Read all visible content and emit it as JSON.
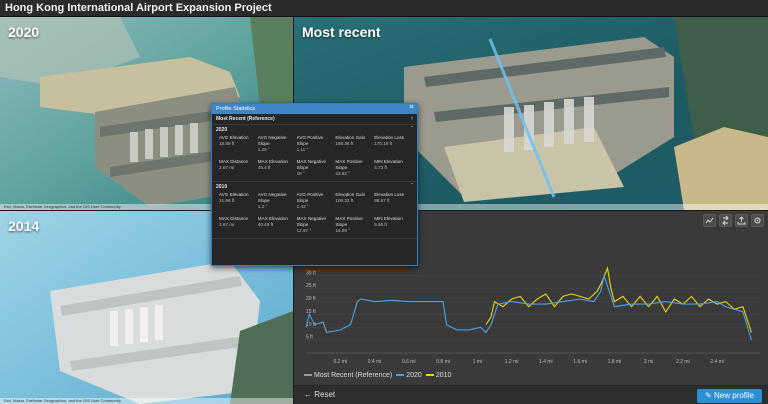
{
  "app": {
    "title": "Hong Kong International Airport Expansion Project"
  },
  "panes": {
    "p2020": {
      "label": "2020",
      "attribution": "Esri, Maxar, Earthstar Geographics, and the GIS User Community"
    },
    "recent": {
      "label": "Most recent",
      "attribution": "Esri, Maxar, Earthstar Geographics, and the GIS User Community"
    },
    "p2014": {
      "label": "2014",
      "attribution": "Esri, Maxar, Earthstar Geographics, and the GIS User Community"
    }
  },
  "stats": {
    "title": "Profile Statistics",
    "reference": "Most Recent (Reference)",
    "groups": [
      {
        "name": "2020",
        "items": [
          {
            "label": "AVG Elevation",
            "value": "18.89 ft"
          },
          {
            "label": "AVG Negative Slope",
            "value": "1.29 °"
          },
          {
            "label": "AVG Positive Slope",
            "value": "1.11 °"
          },
          {
            "label": "Elevation Gain",
            "value": "168.36 ft"
          },
          {
            "label": "Elevation Loss",
            "value": "170.18 ft"
          },
          {
            "label": "MAX Distance",
            "value": "2.67 mi"
          },
          {
            "label": "MAX Elevation",
            "value": "45.4 ft"
          },
          {
            "label": "MAX Negative Slope",
            "value": "18 °"
          },
          {
            "label": "MAX Positive Slope",
            "value": "23.82 °"
          },
          {
            "label": "MIN Elevation",
            "value": "4.73 ft"
          }
        ]
      },
      {
        "name": "2010",
        "items": [
          {
            "label": "AVG Elevation",
            "value": "21.96 ft"
          },
          {
            "label": "AVG Negative Slope",
            "value": "1.2 °"
          },
          {
            "label": "AVG Positive Slope",
            "value": "1.43 °"
          },
          {
            "label": "Elevation Gain",
            "value": "108.32 ft"
          },
          {
            "label": "Elevation Loss",
            "value": "98.57 ft"
          },
          {
            "label": "MAX Distance",
            "value": "2.67 mi"
          },
          {
            "label": "MAX Elevation",
            "value": "40.49 ft"
          },
          {
            "label": "MAX Negative Slope",
            "value": "12.97 °"
          },
          {
            "label": "MAX Positive Slope",
            "value": "16.09 °"
          },
          {
            "label": "MIN Elevation",
            "value": "5.95 ft"
          }
        ]
      }
    ]
  },
  "profile": {
    "yticks": [
      "30 ft",
      "25 ft",
      "20 ft",
      "15 ft",
      "10 ft",
      "5 ft"
    ],
    "xticks": [
      "0.2 mi",
      "0.4 mi",
      "0.6 mi",
      "0.8 mi",
      "1 mi",
      "1.2 mi",
      "1.4 mi",
      "1.6 mi",
      "1.8 mi",
      "2 mi",
      "2.2 mi",
      "2.4 mi"
    ],
    "legend": [
      {
        "name": "Most Recent (Reference)",
        "color": "#9a9a9a"
      },
      {
        "name": "2020",
        "color": "#4aa3e8"
      },
      {
        "name": "2010",
        "color": "#f0d400"
      }
    ],
    "series2020": [
      [
        0,
        10
      ],
      [
        0.02,
        15
      ],
      [
        0.05,
        11
      ],
      [
        0.1,
        12
      ],
      [
        0.12,
        8
      ],
      [
        0.2,
        9
      ],
      [
        0.26,
        11
      ],
      [
        0.3,
        20
      ],
      [
        0.32,
        21
      ],
      [
        0.4,
        20
      ],
      [
        0.5,
        20.5
      ],
      [
        0.6,
        20
      ],
      [
        0.7,
        20
      ],
      [
        0.8,
        20
      ],
      [
        0.82,
        11
      ],
      [
        0.88,
        9
      ],
      [
        0.95,
        9
      ],
      [
        1.02,
        10
      ],
      [
        1.05,
        8
      ],
      [
        1.08,
        11
      ],
      [
        1.12,
        19
      ],
      [
        1.2,
        20
      ],
      [
        1.3,
        19
      ],
      [
        1.4,
        19
      ],
      [
        1.5,
        20
      ],
      [
        1.6,
        21
      ],
      [
        1.68,
        20
      ],
      [
        1.72,
        24
      ],
      [
        1.74,
        30
      ],
      [
        1.76,
        26
      ],
      [
        1.78,
        22
      ],
      [
        1.8,
        18
      ],
      [
        1.9,
        19
      ],
      [
        2.0,
        19
      ],
      [
        2.1,
        20
      ],
      [
        2.2,
        19
      ],
      [
        2.3,
        19
      ],
      [
        2.4,
        20
      ],
      [
        2.45,
        18
      ],
      [
        2.5,
        17
      ],
      [
        2.55,
        16
      ],
      [
        2.6,
        5
      ]
    ],
    "series2010": [
      [
        1.05,
        11
      ],
      [
        1.08,
        14
      ],
      [
        1.1,
        20
      ],
      [
        1.15,
        18
      ],
      [
        1.2,
        21
      ],
      [
        1.25,
        22
      ],
      [
        1.3,
        18
      ],
      [
        1.35,
        21
      ],
      [
        1.4,
        23
      ],
      [
        1.45,
        18
      ],
      [
        1.5,
        22
      ],
      [
        1.55,
        23
      ],
      [
        1.6,
        22
      ],
      [
        1.65,
        21
      ],
      [
        1.7,
        24
      ],
      [
        1.73,
        28
      ],
      [
        1.76,
        33
      ],
      [
        1.78,
        25
      ],
      [
        1.8,
        20
      ],
      [
        1.85,
        22
      ],
      [
        1.9,
        18
      ],
      [
        1.95,
        22
      ],
      [
        2.0,
        18
      ],
      [
        2.05,
        22
      ],
      [
        2.1,
        16
      ],
      [
        2.15,
        21
      ],
      [
        2.2,
        19
      ],
      [
        2.25,
        22
      ],
      [
        2.3,
        18
      ],
      [
        2.35,
        21
      ],
      [
        2.4,
        19
      ],
      [
        2.45,
        20
      ],
      [
        2.5,
        17
      ],
      [
        2.55,
        18
      ],
      [
        2.6,
        8
      ]
    ]
  },
  "toolbar": {
    "reset_label": "Reset",
    "new_profile_label": "New profile"
  },
  "icons": {
    "reset": "arrow-left-icon",
    "edit": "pencil-icon",
    "close": "close-icon"
  }
}
